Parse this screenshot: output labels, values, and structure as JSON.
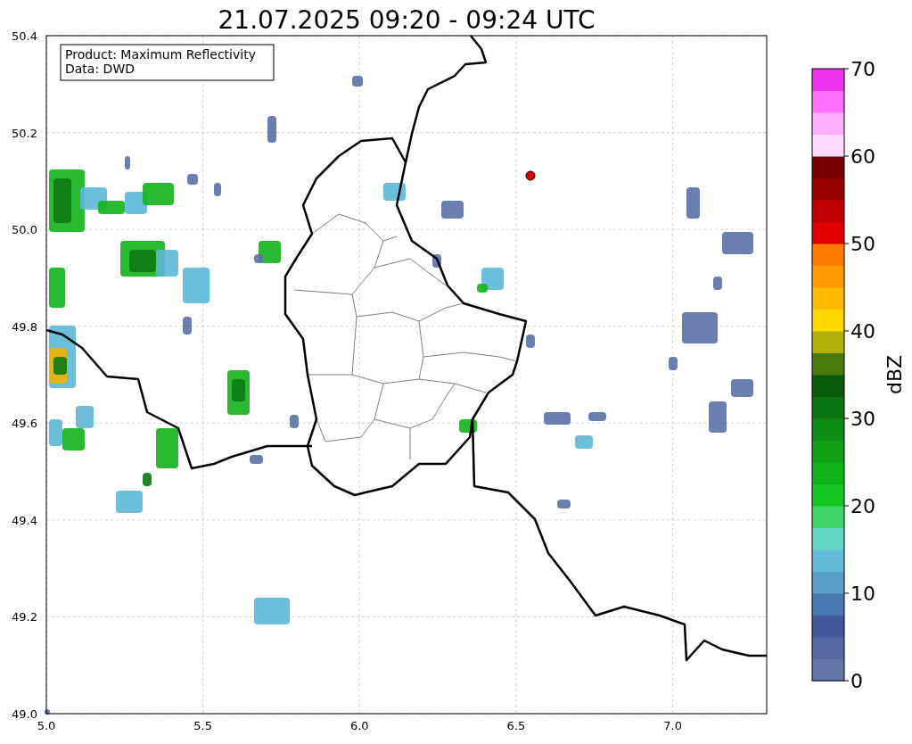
{
  "title": "21.07.2025 09:20 - 09:24 UTC",
  "info_box": {
    "lines": [
      "Product: Maximum Reflectivity",
      "Data: DWD"
    ]
  },
  "x_ticks": [
    "5.0",
    "5.5",
    "6.0",
    "6.5",
    "7.0"
  ],
  "y_ticks": [
    "50.4",
    "50.2",
    "50.0",
    "49.8",
    "49.6",
    "49.4",
    "49.2",
    "49.0"
  ],
  "colorbar": {
    "label": "dBZ",
    "ticks": [
      "70",
      "60",
      "50",
      "40",
      "30",
      "20",
      "10",
      "0"
    ],
    "bins": [
      {
        "color": "#6577a9"
      },
      {
        "color": "#5669a1"
      },
      {
        "color": "#43589c"
      },
      {
        "color": "#4a78b0"
      },
      {
        "color": "#5b9fc8"
      },
      {
        "color": "#62bcd9"
      },
      {
        "color": "#62d7c6"
      },
      {
        "color": "#3ed46a"
      },
      {
        "color": "#12c51f"
      },
      {
        "color": "#10b317"
      },
      {
        "color": "#0fa016"
      },
      {
        "color": "#0e8d14"
      },
      {
        "color": "#0b7411"
      },
      {
        "color": "#0a5a0e"
      },
      {
        "color": "#487a0e"
      },
      {
        "color": "#b0b008"
      },
      {
        "color": "#ffd800"
      },
      {
        "color": "#ffb900"
      },
      {
        "color": "#ff9a00"
      },
      {
        "color": "#ff7a00"
      },
      {
        "color": "#e00000"
      },
      {
        "color": "#c00000"
      },
      {
        "color": "#9a0000"
      },
      {
        "color": "#780000"
      },
      {
        "color": "#ffdcff"
      },
      {
        "color": "#ffafff"
      },
      {
        "color": "#ff6eff"
      },
      {
        "color": "#ee33ee"
      }
    ]
  }
}
